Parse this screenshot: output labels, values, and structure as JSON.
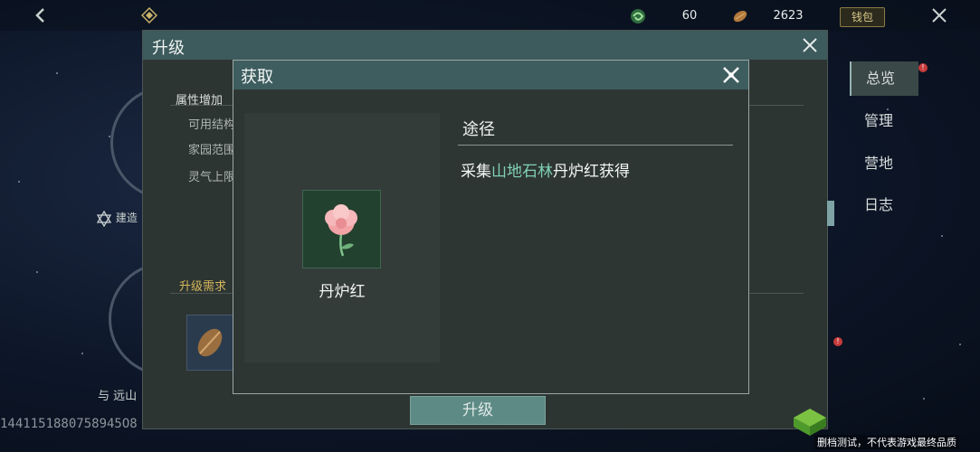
{
  "topbar": {
    "resource1_value": "60",
    "resource2_value": "2623",
    "wallet_label": "钱包"
  },
  "upgrade_panel": {
    "title": "升级",
    "attr_title": "属性增加",
    "attr_items": [
      "可用结构",
      "家园范围",
      "灵气上限"
    ],
    "requirements_title": "升级需求",
    "upgrade_button": "升级"
  },
  "left_area": {
    "build_label": "建造",
    "caption": "与 远山",
    "uid": "1441151880758945O8"
  },
  "side_nav": {
    "items": [
      {
        "label": "总览",
        "active": true,
        "badge": true
      },
      {
        "label": "管理"
      },
      {
        "label": "营地"
      },
      {
        "label": "日志"
      }
    ]
  },
  "modal": {
    "title": "获取",
    "item_name": "丹炉红",
    "route_title": "途径",
    "route_prefix": "采集",
    "route_location": "山地石林",
    "route_suffix": "丹炉红获得"
  },
  "watermark": {
    "text": "删档测试，不代表游戏最终品质"
  },
  "colors": {
    "accent": "#3e5d5f",
    "highlight": "#7fd0b3",
    "badge": "#c73b3b",
    "requirement": "#d6b65c"
  }
}
